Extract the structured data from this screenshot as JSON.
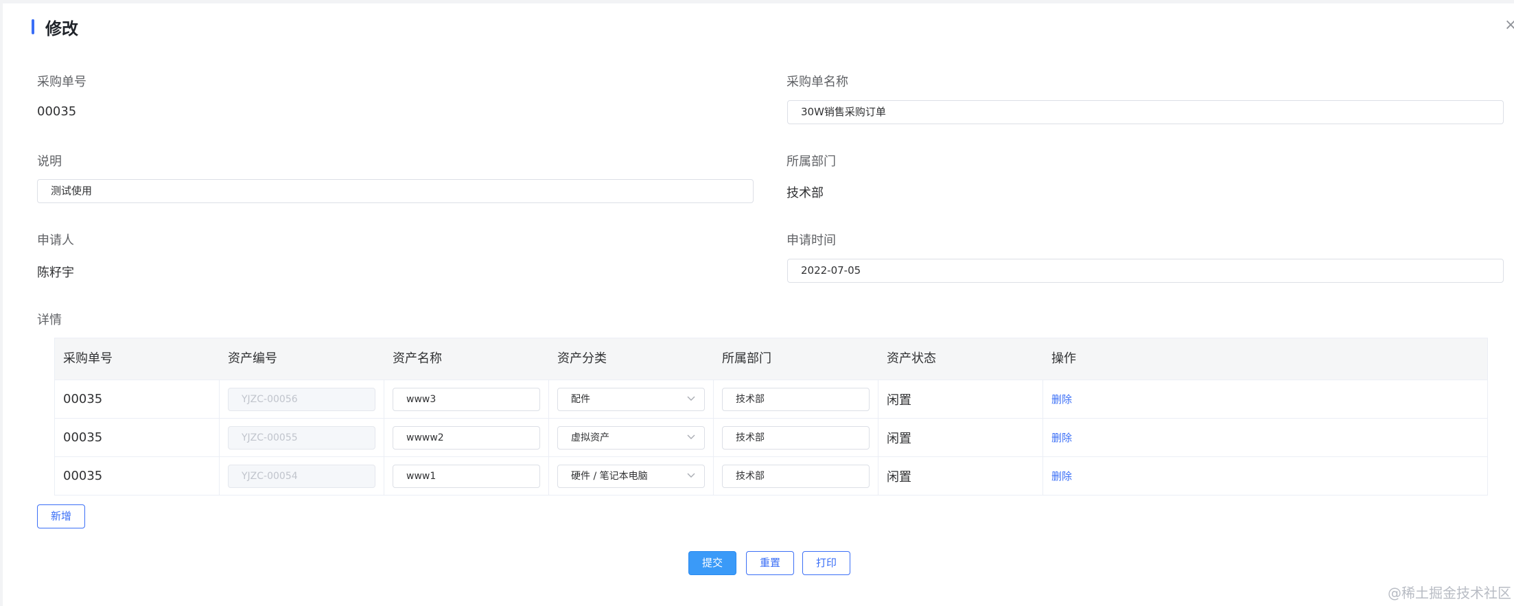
{
  "dialog": {
    "title": "修改"
  },
  "form": {
    "order_no": {
      "label": "采购单号",
      "value": "00035"
    },
    "order_name": {
      "label": "采购单名称",
      "value": "30W销售采购订单"
    },
    "description": {
      "label": "说明",
      "value": "测试使用"
    },
    "department": {
      "label": "所属部门",
      "value": "技术部"
    },
    "applicant": {
      "label": "申请人",
      "value": "陈籽宇"
    },
    "apply_time": {
      "label": "申请时间",
      "value": "2022-07-05"
    },
    "details_label": "详情"
  },
  "table": {
    "columns": [
      "采购单号",
      "资产编号",
      "资产名称",
      "资产分类",
      "所属部门",
      "资产状态",
      "操作"
    ],
    "rows": [
      {
        "order_no": "00035",
        "asset_no": "YJZC-00056",
        "asset_name": "www3",
        "category": "配件",
        "department": "技术部",
        "status": "闲置",
        "action": "删除"
      },
      {
        "order_no": "00035",
        "asset_no": "YJZC-00055",
        "asset_name": "wwww2",
        "category": "虚拟资产",
        "department": "技术部",
        "status": "闲置",
        "action": "删除"
      },
      {
        "order_no": "00035",
        "asset_no": "YJZC-00054",
        "asset_name": "www1",
        "category": "硬件 / 笔记本电脑",
        "department": "技术部",
        "status": "闲置",
        "action": "删除"
      }
    ]
  },
  "buttons": {
    "add": "新增",
    "submit": "提交",
    "reset": "重置",
    "print": "打印"
  },
  "watermark": "@稀土掘金技术社区",
  "colors": {
    "accent": "#3a6ef6",
    "primary_button": "#3a9af8"
  }
}
